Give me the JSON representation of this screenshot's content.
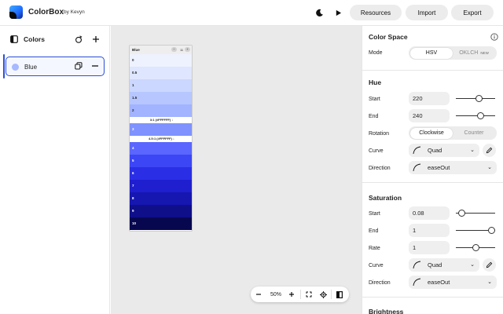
{
  "app": {
    "title": "ColorBox",
    "byline": "by Kevyn"
  },
  "header": {
    "resources_label": "Resources",
    "import_label": "Import",
    "export_label": "Export"
  },
  "sidebar": {
    "title": "Colors",
    "items": [
      {
        "label": "Blue",
        "swatch_color": "#a6b8ff"
      }
    ]
  },
  "palette": {
    "name": "Blue",
    "count": "11",
    "shades": [
      {
        "label": "0",
        "color": "#eef2ff",
        "text_color": "#222"
      },
      {
        "label": "0.5",
        "color": "#dfe6ff",
        "text_color": "#222"
      },
      {
        "label": "1",
        "color": "#ccd7ff",
        "text_color": "#222"
      },
      {
        "label": "1.5",
        "color": "#b7c6ff",
        "text_color": "#222"
      },
      {
        "label": "2",
        "color": "#a2b3ff",
        "text_color": "#222"
      },
      {
        "label": "3",
        "color": "#7f92ff",
        "text_color": "#fff"
      },
      {
        "label": "4",
        "color": "#5a66ff",
        "text_color": "#fff"
      },
      {
        "label": "5",
        "color": "#3c46f5",
        "text_color": "#fff"
      },
      {
        "label": "6",
        "color": "#2a2fe6",
        "text_color": "#fff"
      },
      {
        "label": "7",
        "color": "#1f1fcf",
        "text_color": "#fff"
      },
      {
        "label": "8",
        "color": "#1616b0",
        "text_color": "#fff"
      },
      {
        "label": "9",
        "color": "#0f0f8a",
        "text_color": "#fff"
      },
      {
        "label": "10",
        "color": "#070750",
        "text_color": "#fff"
      }
    ],
    "contrast_1": "3:1 (#FFFFFF) ↓",
    "contrast_2": "4.5:1 (#FFFFFF) ↓"
  },
  "zoom": {
    "level": "50%"
  },
  "colorspace": {
    "title": "Color Space",
    "mode_label": "Mode",
    "option_a": "HSV",
    "option_b": "OKLCH",
    "option_b_badge": "NEW"
  },
  "hue": {
    "title": "Hue",
    "start_label": "Start",
    "start_value": "220",
    "start_fraction": 0.61,
    "end_label": "End",
    "end_value": "240",
    "end_fraction": 0.67,
    "rotation_label": "Rotation",
    "rotation_a": "Clockwise",
    "rotation_b": "Counter",
    "curve_label": "Curve",
    "curve_value": "Quad",
    "direction_label": "Direction",
    "direction_value": "easeOut"
  },
  "saturation": {
    "title": "Saturation",
    "start_label": "Start",
    "start_value": "0.08",
    "start_fraction": 0.08,
    "end_label": "End",
    "end_value": "1",
    "end_fraction": 1,
    "rate_label": "Rate",
    "rate_value": "1",
    "rate_fraction": 0.5,
    "curve_label": "Curve",
    "curve_value": "Quad",
    "direction_label": "Direction",
    "direction_value": "easeOut"
  },
  "brightness": {
    "title": "Brightness"
  }
}
